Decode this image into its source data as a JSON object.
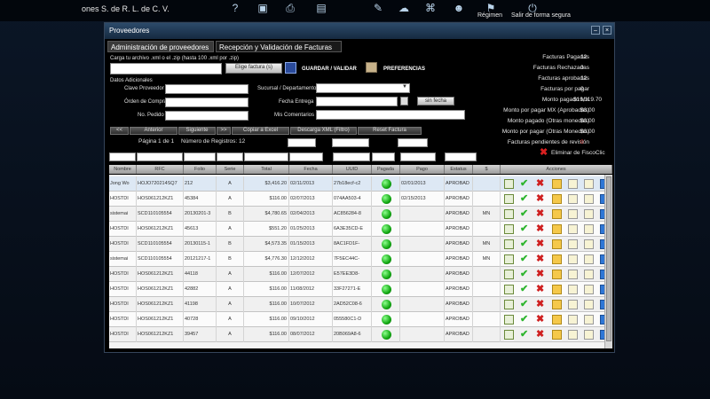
{
  "company": "ones S. de R. L. de C. V.",
  "toolbar": {
    "items": [
      "help-icon",
      "monitor-icon",
      "printer-icon",
      "news-icon",
      "tools-icon",
      "cloud-icon",
      "network-icon",
      "users-icon"
    ],
    "regimen_label": "Régimen",
    "logout_label": "Salir de forma segura"
  },
  "window": {
    "title": "Proveedores",
    "tabs": [
      "Administración de proveedores",
      "Recepción y Validación de Facturas"
    ]
  },
  "upload": {
    "label": "Carga tu archivo .xml o el .zip (hasta 100 .xml por .zip)",
    "choose_label": "Elige factura (s)",
    "save_label": "GUARDAR / VALIDAR",
    "prefs_label": "PREFERENCIAS"
  },
  "form": {
    "additional_label": "Datos Adicionales",
    "clave_label": "Clave Proveedor",
    "orden_label": "Órden de Compra",
    "pedido_label": "No. Pedido",
    "sucursal_label": "Sucursal / Departamento",
    "fecha_label": "Fecha Entrega",
    "sin_fecha_label": "sin fecha",
    "comentarios_label": "Mis Comentarios"
  },
  "nav": {
    "buttons": [
      "<<",
      "Anterior",
      "Siguiente",
      ">>",
      "Copiar a Excel",
      "Descarga XML (Filtro)",
      "Reset Factura"
    ],
    "page_label": "Página 1 de 1",
    "records_label": "Número de Registros: 12"
  },
  "stats": [
    {
      "label": "Facturas Pagadas",
      "value": "12"
    },
    {
      "label": "Facturas Rechazadas",
      "value": "0"
    },
    {
      "label": "Facturas aprobadas",
      "value": "12"
    },
    {
      "label": "Facturas por pagar",
      "value": "0"
    },
    {
      "label": "Monto pagado MX",
      "value": "$19,119.70"
    },
    {
      "label": "Monto por pagar MX (Aprobadas)",
      "value": "$0.00"
    },
    {
      "label": "Monto pagado (Otras monedas)",
      "value": "$0.00"
    },
    {
      "label": "Monto por pagar (Otras Monedas)",
      "value": "$0.00"
    },
    {
      "label": "Facturas pendientes de revisión",
      "value": "0"
    }
  ],
  "delete_label": "Eliminar de FiscoClic",
  "table": {
    "headers": [
      "Nombre",
      "RFC",
      "Folio",
      "Serie",
      "Total",
      "Fecha",
      "UUID",
      "Pagada",
      "Pago",
      "Estatus",
      "$",
      "Acciones"
    ],
    "rows": [
      [
        "Jong Wo",
        "HOJO720214SQ7",
        "212",
        "A",
        "$3,416.20",
        "02/11/2013",
        "27b18ecf-c2",
        "",
        "02/01/2013",
        "APROBAD",
        ""
      ],
      [
        "HOSTDI",
        "HOS061212KZ1",
        "45384",
        "A",
        "$116.00",
        "02/07/2013",
        "074AA503-4",
        "",
        "02/15/2013",
        "APROBAD",
        ""
      ],
      [
        "sistemai",
        "SCD110105554",
        "20130201-3",
        "B",
        "$4,780.65",
        "02/04/2013",
        "AC856284-8",
        "",
        "",
        "APROBAD",
        "MN"
      ],
      [
        "HOSTDI",
        "HOS061212KZ1",
        "45613",
        "A",
        "$551.20",
        "01/25/2013",
        "6A3E35CD-E",
        "",
        "",
        "APROBAD",
        ""
      ],
      [
        "HOSTDI",
        "SCD110105554",
        "20130115-1",
        "B",
        "$4,573.35",
        "01/15/2013",
        "8AC1FD1F-",
        "",
        "",
        "APROBAD",
        "MN"
      ],
      [
        "sistemai",
        "SCD110105554",
        "20121217-1",
        "B",
        "$4,776.30",
        "12/12/2012",
        "7F5EC44C-",
        "",
        "",
        "APROBAD",
        "MN"
      ],
      [
        "HOSTDI",
        "HOS061212KZ1",
        "44118",
        "A",
        "$116.00",
        "12/07/2012",
        "E57EE3D8-",
        "",
        "",
        "APROBAD",
        ""
      ],
      [
        "HOSTDI",
        "HOS061212KZ1",
        "42882",
        "A",
        "$116.00",
        "11/08/2012",
        "33F27271-E",
        "",
        "",
        "APROBAD",
        ""
      ],
      [
        "HOSTDI",
        "HOS061212KZ1",
        "41198",
        "A",
        "$116.00",
        "10/07/2012",
        "2AD52C08-6",
        "",
        "",
        "APROBAD",
        ""
      ],
      [
        "HOSTDI",
        "HOS061212KZ1",
        "40728",
        "A",
        "$116.00",
        "09/10/2012",
        "055580C1-D",
        "",
        "",
        "APROBAD",
        ""
      ],
      [
        "HOSTDI",
        "HOS061212KZ1",
        "39457",
        "A",
        "$116.00",
        "08/07/2012",
        "20B069A8-6",
        "",
        "",
        "APROBAD",
        ""
      ]
    ]
  },
  "actions": [
    "add-note-icon",
    "approve-check-icon",
    "reject-x-icon",
    "email-icon",
    "xml-file-icon",
    "pdf-file-icon",
    "download-icon"
  ]
}
